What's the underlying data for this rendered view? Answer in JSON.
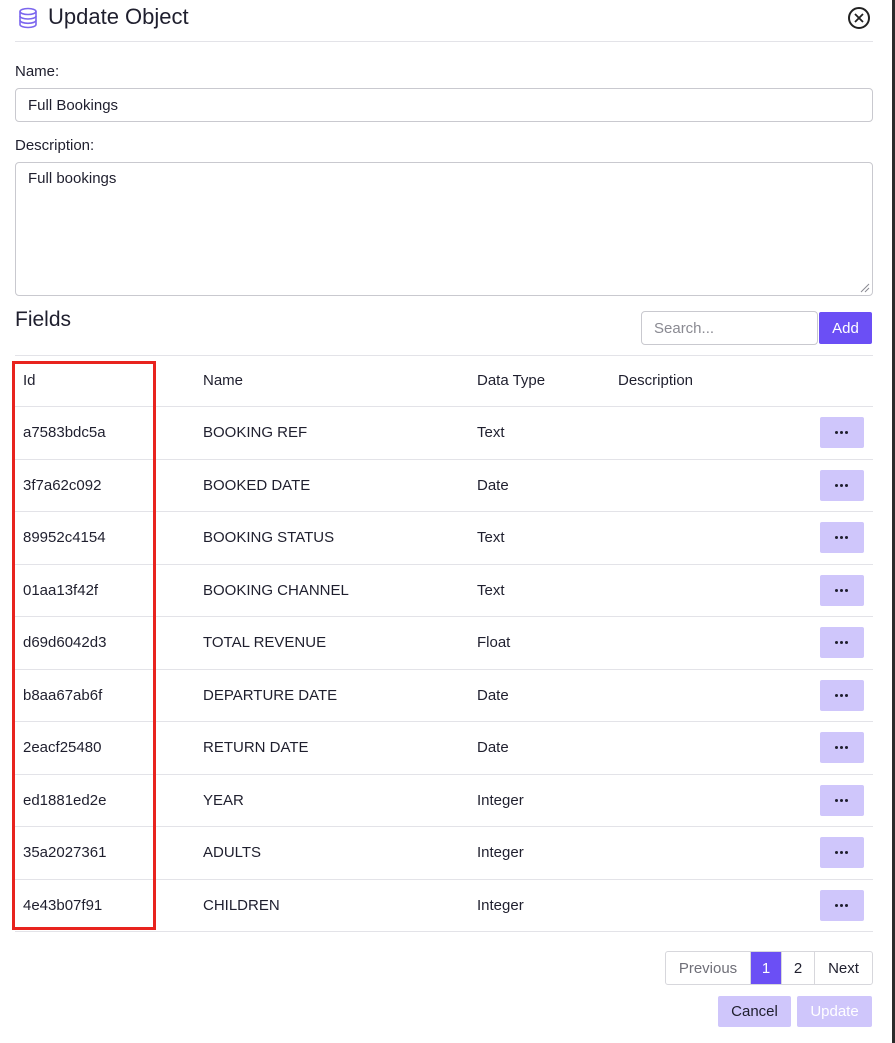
{
  "header": {
    "title": "Update Object",
    "icon": "database-icon",
    "close_icon": "close-circle-icon"
  },
  "form": {
    "name_label": "Name:",
    "name_value": "Full Bookings",
    "description_label": "Description:",
    "description_value": "Full bookings"
  },
  "fields": {
    "title": "Fields",
    "search_placeholder": "Search...",
    "add_label": "Add",
    "columns": [
      "Id",
      "Name",
      "Data Type",
      "Description"
    ],
    "rows": [
      {
        "id": "a7583bdc5a",
        "name": "BOOKING REF",
        "type": "Text",
        "description": ""
      },
      {
        "id": "3f7a62c092",
        "name": "BOOKED DATE",
        "type": "Date",
        "description": ""
      },
      {
        "id": "89952c4154",
        "name": "BOOKING STATUS",
        "type": "Text",
        "description": ""
      },
      {
        "id": "01aa13f42f",
        "name": "BOOKING CHANNEL",
        "type": "Text",
        "description": ""
      },
      {
        "id": "d69d6042d3",
        "name": "TOTAL REVENUE",
        "type": "Float",
        "description": ""
      },
      {
        "id": "b8aa67ab6f",
        "name": "DEPARTURE DATE",
        "type": "Date",
        "description": ""
      },
      {
        "id": "2eacf25480",
        "name": "RETURN DATE",
        "type": "Date",
        "description": ""
      },
      {
        "id": "ed1881ed2e",
        "name": "YEAR",
        "type": "Integer",
        "description": ""
      },
      {
        "id": "35a2027361",
        "name": "ADULTS",
        "type": "Integer",
        "description": ""
      },
      {
        "id": "4e43b07f91",
        "name": "CHILDREN",
        "type": "Integer",
        "description": ""
      }
    ],
    "row_action_icon": "more-horizontal-icon"
  },
  "pagination": {
    "previous": "Previous",
    "pages": [
      "1",
      "2"
    ],
    "current": "1",
    "next": "Next"
  },
  "footer": {
    "cancel_label": "Cancel",
    "update_label": "Update"
  },
  "colors": {
    "accent": "#6b4ff5",
    "accent_light": "#cfc6fb",
    "highlight": "#e8231e"
  }
}
